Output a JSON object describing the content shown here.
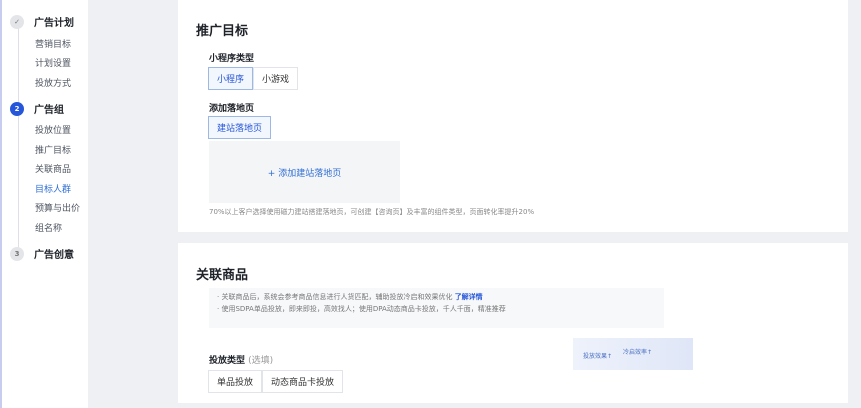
{
  "sidebar": {
    "steps": [
      {
        "num": "✓",
        "label": "广告计划",
        "items": [
          "营销目标",
          "计划设置",
          "投放方式"
        ]
      },
      {
        "num": "2",
        "label": "广告组",
        "items": [
          "投放位置",
          "推广目标",
          "关联商品",
          "目标人群",
          "预算与出价",
          "组名称"
        ]
      },
      {
        "num": "3",
        "label": "广告创意"
      }
    ],
    "active_item": "目标人群"
  },
  "promo": {
    "title": "推广目标",
    "type_label": "小程序类型",
    "types": [
      "小程序",
      "小游戏"
    ],
    "landing_label": "添加落地页",
    "landing_tab": "建站落地页",
    "add_landing": "+ 添加建站落地页",
    "hint": "70%以上客户选择使用磁力建站搭建落地页，可创建【咨询页】及丰富的组件类型，页面转化率提升20%"
  },
  "products": {
    "title": "关联商品",
    "info1": "· 关联商品后，系统会参考商品信息进行人货匹配，辅助投放冷启和效果优化",
    "info_link": "了解详情",
    "info2": "· 使用SDPA单品投放，即来即投，高效找人；使用DPA动态商品卡投放，千人千面，精准推荐",
    "illus_a": "投放效果↑",
    "illus_b": "冷启效率↑",
    "type_label": "投放类型",
    "optional": "(选填)",
    "types": [
      "单品投放",
      "动态商品卡投放"
    ]
  }
}
